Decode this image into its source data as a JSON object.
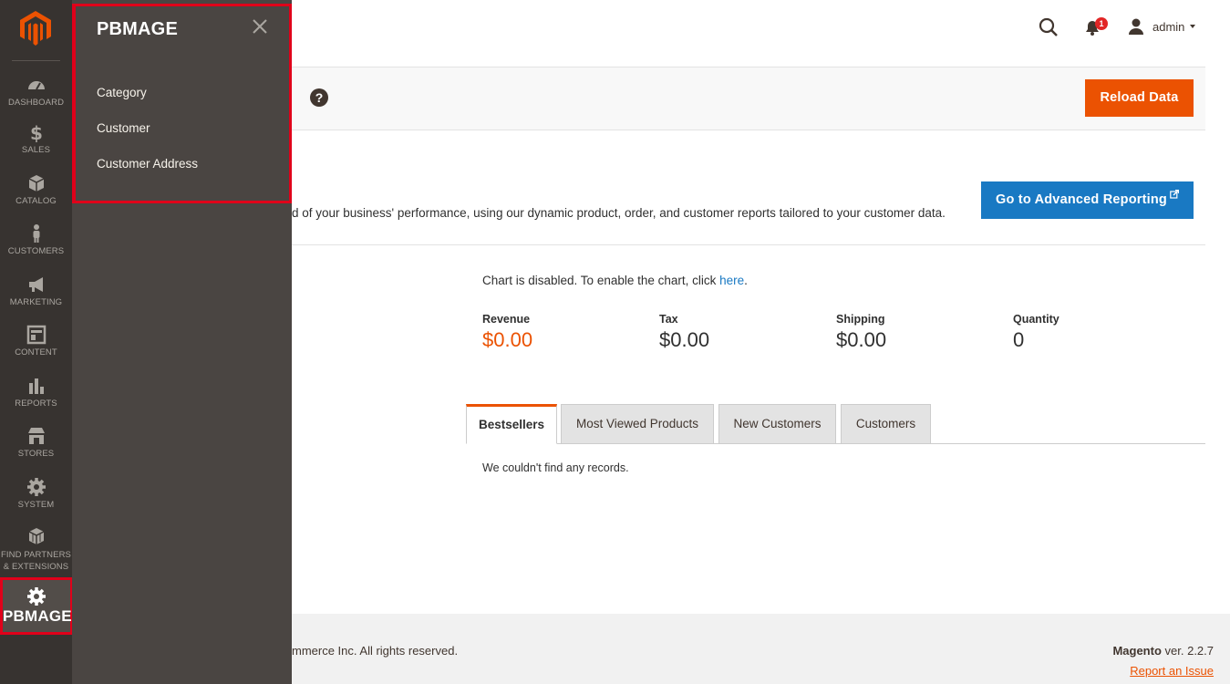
{
  "nav": {
    "items": [
      {
        "label": "DASHBOARD",
        "icon": "dashboard-icon"
      },
      {
        "label": "SALES",
        "icon": "dollar-icon"
      },
      {
        "label": "CATALOG",
        "icon": "cube-icon"
      },
      {
        "label": "CUSTOMERS",
        "icon": "person-icon"
      },
      {
        "label": "MARKETING",
        "icon": "megaphone-icon"
      },
      {
        "label": "CONTENT",
        "icon": "layout-icon"
      },
      {
        "label": "REPORTS",
        "icon": "bar-chart-icon"
      },
      {
        "label": "STORES",
        "icon": "store-icon"
      },
      {
        "label": "SYSTEM",
        "icon": "gear-icon"
      },
      {
        "label_line1": "FIND PARTNERS",
        "label_line2": "& EXTENSIONS",
        "icon": "boxes-icon"
      }
    ],
    "pbmage": {
      "label": "PBMAGE",
      "icon": "gear-icon"
    }
  },
  "flyout": {
    "title": "PBMAGE",
    "links": [
      "Category",
      "Customer",
      "Customer Address"
    ]
  },
  "header": {
    "notification_count": "1",
    "user_name": "admin"
  },
  "actions": {
    "help": "?",
    "reload_label": "Reload Data"
  },
  "advanced": {
    "text": "d of your business' performance, using our dynamic product, order, and customer reports tailored to your customer data.",
    "button_label": "Go to Advanced Reporting"
  },
  "chart": {
    "message": "Chart is disabled. To enable the chart, click ",
    "link": "here",
    "suffix": "."
  },
  "totals": [
    {
      "label": "Revenue",
      "value": "$0.00"
    },
    {
      "label": "Tax",
      "value": "$0.00"
    },
    {
      "label": "Shipping",
      "value": "$0.00"
    },
    {
      "label": "Quantity",
      "value": "0"
    }
  ],
  "tabs": [
    "Bestsellers",
    "Most Viewed Products",
    "New Customers",
    "Customers"
  ],
  "tab_content": {
    "empty": "We couldn't find any records."
  },
  "footer": {
    "copyright": "mmerce Inc. All rights reserved.",
    "brand": "Magento",
    "version": " ver. 2.2.7",
    "report_issue": "Report an Issue"
  },
  "colors": {
    "accent": "#eb5202",
    "link": "#1979c3",
    "nav_bg": "#373330",
    "flyout_bg": "#4a4542",
    "highlight": "#e0001a"
  }
}
